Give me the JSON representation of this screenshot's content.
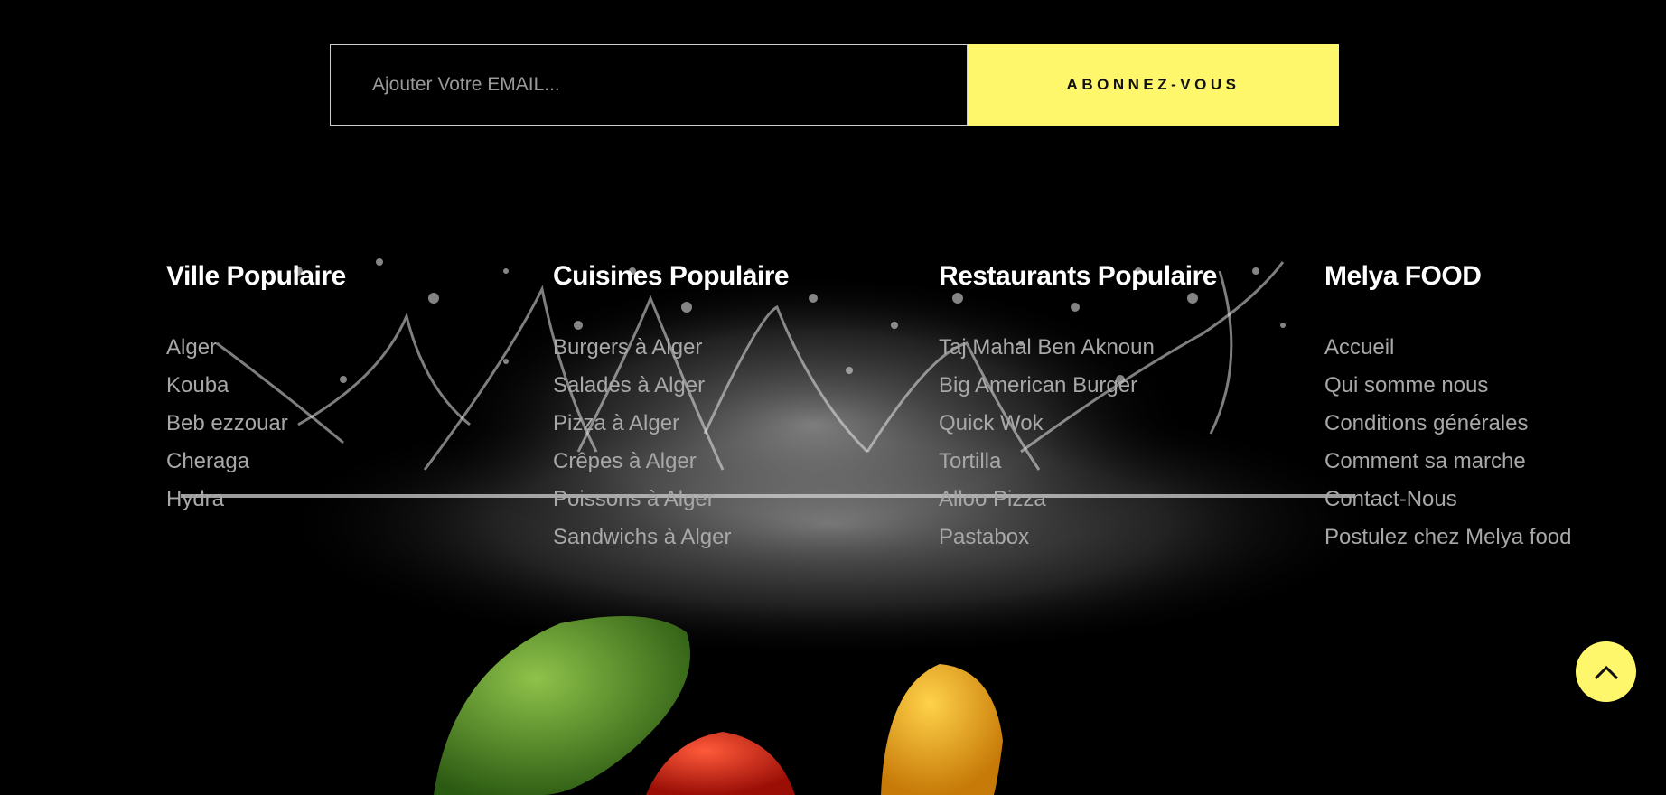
{
  "newsletter": {
    "email_placeholder": "Ajouter Votre EMAIL...",
    "subscribe_label": "ABONNEZ-VOUS"
  },
  "columns": [
    {
      "title": "Ville Populaire",
      "links": [
        "Alger",
        "Kouba",
        "Beb ezzouar",
        "Cheraga",
        "Hydra"
      ]
    },
    {
      "title": "Cuisines Populaire",
      "links": [
        "Burgers à Alger",
        "Salades à Alger",
        "Pizza à Alger",
        "Crêpes à Alger",
        "Poissons à Alger",
        "Sandwichs à Alger"
      ]
    },
    {
      "title": "Restaurants Populaire",
      "links": [
        "Taj Mahal Ben Aknoun",
        "Big American Burger",
        "Quick Wok",
        "Tortilla",
        "Alloo Pizza",
        "Pastabox"
      ]
    },
    {
      "title": "Melya FOOD",
      "links": [
        "Accueil",
        "Qui somme nous",
        "Conditions générales",
        "Comment sa marche",
        "Contact-Nous",
        "Postulez chez Melya food"
      ]
    }
  ],
  "colors": {
    "accent": "#fef76b",
    "background": "#000000",
    "link": "#a8a8a8"
  },
  "icons": {
    "back_to_top": "chevron-up-icon"
  }
}
